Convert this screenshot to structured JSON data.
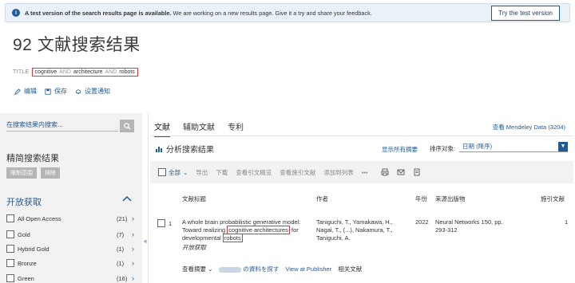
{
  "banner": {
    "bold_text": "A test version of the search results page is available.",
    "text": " We are working on a new results page. Give it a try and share your feedback.",
    "button": "Try the test version"
  },
  "page_title": "92 文献搜索结果",
  "query": {
    "label": "TITLE",
    "term1": "cognitive",
    "op1": "AND",
    "term2": "architecture",
    "op2": "AND",
    "term3": "robots"
  },
  "actions": {
    "edit": "编辑",
    "save": "保存",
    "alert": "设置通知"
  },
  "sidebar": {
    "search_placeholder": "在搜索结果内搜索...",
    "refine_title": "精简搜索结果",
    "limit_button": "限制范围",
    "exclude_button": "排除",
    "open_access_title": "开放获取",
    "filters": [
      {
        "label": "All Open Access",
        "count": "(21)"
      },
      {
        "label": "Gold",
        "count": "(7)"
      },
      {
        "label": "Hybrid Gold",
        "count": "(1)"
      },
      {
        "label": "Bronze",
        "count": "(1)"
      },
      {
        "label": "Green",
        "count": "(16)"
      }
    ]
  },
  "collapse_label": "«",
  "tabs": [
    "文献",
    "辅助文献",
    "专利"
  ],
  "mendeley": "查看 Mendeley Data (3204)",
  "analyze": "分析搜索结果",
  "show_abstracts": "显示所有摘要",
  "sort": {
    "label": "排序对象:",
    "value": "日期 (降序)"
  },
  "toolbar": {
    "select_all": "全部",
    "export": "导出",
    "download": "下载",
    "citation_overview": "查看引文概览",
    "cited_by": "查看施引文献",
    "add_to_list": "添加到列表",
    "more": "•••"
  },
  "columns": {
    "title": "文献标题",
    "authors": "作者",
    "year": "年份",
    "source": "来源出版物",
    "cited": "施引文献"
  },
  "result": {
    "num": "1",
    "title_part1": "A whole brain probabilistic generative model: Toward realizing ",
    "title_hl1": "cognitive architectures",
    "title_part2": " for developmental ",
    "title_hl2": "robots",
    "open_access": "开放获取",
    "authors": "Taniguchi, T., Yamakawa, H., Nagai, T., (...), Nakamura, T., Taniguchi, A.",
    "year": "2022",
    "source": "Neural Networks 150, pp. 293-312",
    "cited": "1",
    "view_abstract": "查看摘要",
    "find_label": "の資料を探す",
    "publisher_link": "View at Publisher",
    "related": "相关文献"
  }
}
